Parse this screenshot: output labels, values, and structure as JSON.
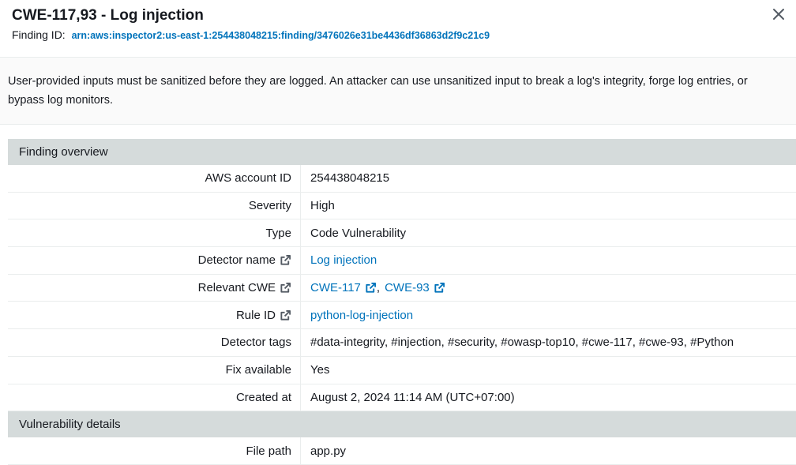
{
  "modal": {
    "title": "CWE-117,93 - Log injection",
    "finding_id_label": "Finding ID:",
    "finding_id": "arn:aws:inspector2:us-east-1:254438048215:finding/3476026e31be4436df36863d2f9c21c9",
    "description": "User-provided inputs must be sanitized before they are logged. An attacker can use unsanitized input to break a log's integrity, forge log entries, or bypass log monitors."
  },
  "overview": {
    "section_title": "Finding overview",
    "rows": [
      {
        "label": "AWS account ID",
        "value": "254438048215"
      },
      {
        "label": "Severity",
        "value": "High"
      },
      {
        "label": "Type",
        "value": "Code Vulnerability"
      },
      {
        "label": "Detector name",
        "value": "Log injection"
      },
      {
        "label": "Relevant CWE",
        "value1": "CWE-117",
        "value2": "CWE-93"
      },
      {
        "label": "Rule ID",
        "value": "python-log-injection"
      },
      {
        "label": "Detector tags",
        "value": "#data-integrity, #injection, #security, #owasp-top10, #cwe-117, #cwe-93, #Python"
      },
      {
        "label": "Fix available",
        "value": "Yes"
      },
      {
        "label": "Created at",
        "value": "August 2, 2024 11:14 AM (UTC+07:00)"
      }
    ]
  },
  "vulnerability": {
    "section_title": "Vulnerability details",
    "rows": [
      {
        "label": "File path",
        "value": "app.py"
      }
    ]
  },
  "colors": {
    "link": "#0073bb",
    "section_bg": "#d5dbdb",
    "text": "#16191f"
  },
  "icons": [
    "close-icon",
    "external-link-icon"
  ]
}
